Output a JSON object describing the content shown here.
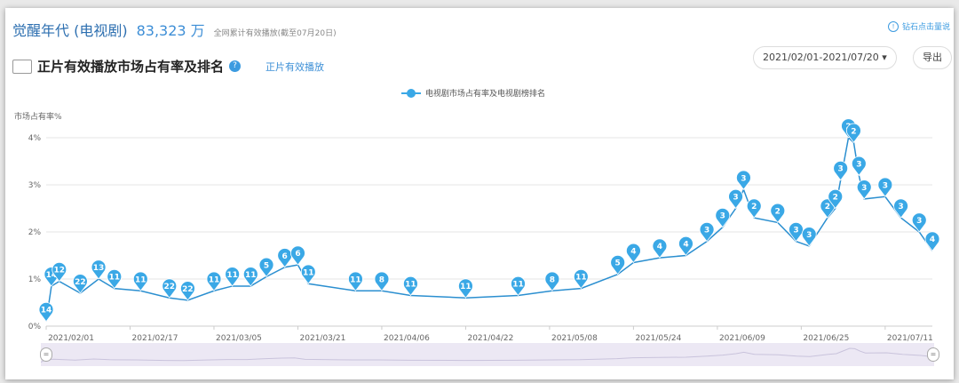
{
  "header": {
    "title": "觉醒年代 (电视剧)",
    "total_plays": "83,323 万",
    "total_note": "全网累计有效播放(截至07月20日)",
    "tip": "钻石点击量说"
  },
  "section": {
    "title": "正片有效播放市场占有率及排名",
    "help_icon": "?",
    "link": "正片有效播放"
  },
  "toolbar": {
    "date_range": "2021/02/01-2021/07/20 ▾",
    "export_label": "导出"
  },
  "colors": {
    "series": "#3aa8e6",
    "grid": "#e6e6e6"
  },
  "chart_data": {
    "type": "line",
    "title": "正片有效播放市场占有率及排名",
    "ylabel": "市场占有率%",
    "xlabel": "",
    "legend": [
      "电视剧市场占有率及电视剧榜排名"
    ],
    "legend_position": "top-center",
    "ylim": [
      0,
      4
    ],
    "yticks": [
      "0%",
      "1%",
      "2%",
      "3%",
      "4%"
    ],
    "xticks": [
      "2021/02/01",
      "2021/02/17",
      "2021/03/05",
      "2021/03/21",
      "2021/04/06",
      "2021/04/22",
      "2021/05/08",
      "2021/05/24",
      "2021/06/09",
      "2021/06/25",
      "2021/07/11"
    ],
    "xtick_days": [
      0,
      16,
      32,
      48,
      64,
      80,
      96,
      112,
      128,
      144,
      160
    ],
    "x_days_total": 169,
    "grid": true,
    "series": [
      {
        "name": "电视剧市场占有率及电视剧榜排名",
        "day": [
          0,
          1,
          2.5,
          6.5,
          10,
          13,
          18,
          23.5,
          27,
          32,
          35.5,
          39,
          42,
          45.5,
          48,
          50,
          59,
          64,
          69.5,
          80,
          90,
          96.5,
          102,
          109,
          112,
          117,
          122,
          126,
          129,
          131.5,
          133,
          135,
          139.5,
          143,
          145.5,
          149,
          150.5,
          151.5,
          153,
          154,
          155,
          156,
          160,
          163,
          166.5,
          169
        ],
        "share": [
          0.1,
          0.85,
          0.95,
          0.7,
          1.0,
          0.8,
          0.75,
          0.6,
          0.55,
          0.75,
          0.85,
          0.85,
          1.05,
          1.25,
          1.3,
          0.9,
          0.75,
          0.75,
          0.65,
          0.6,
          0.65,
          0.75,
          0.8,
          1.1,
          1.35,
          1.45,
          1.5,
          1.8,
          2.1,
          2.5,
          2.9,
          2.3,
          2.2,
          1.8,
          1.7,
          2.3,
          2.5,
          3.1,
          4.0,
          3.9,
          3.2,
          2.7,
          2.75,
          2.3,
          2.0,
          1.6
        ],
        "rank": [
          14,
          14,
          12,
          22,
          13,
          11,
          11,
          22,
          22,
          11,
          11,
          11,
          5,
          6,
          6,
          11,
          11,
          8,
          11,
          11,
          11,
          8,
          11,
          5,
          4,
          4,
          4,
          3,
          3,
          3,
          3,
          2,
          2,
          3,
          3,
          2,
          2,
          3,
          2,
          2,
          3,
          3,
          3,
          3,
          3,
          4
        ]
      }
    ]
  },
  "slider": {
    "start_handle": "=",
    "end_handle": "="
  }
}
